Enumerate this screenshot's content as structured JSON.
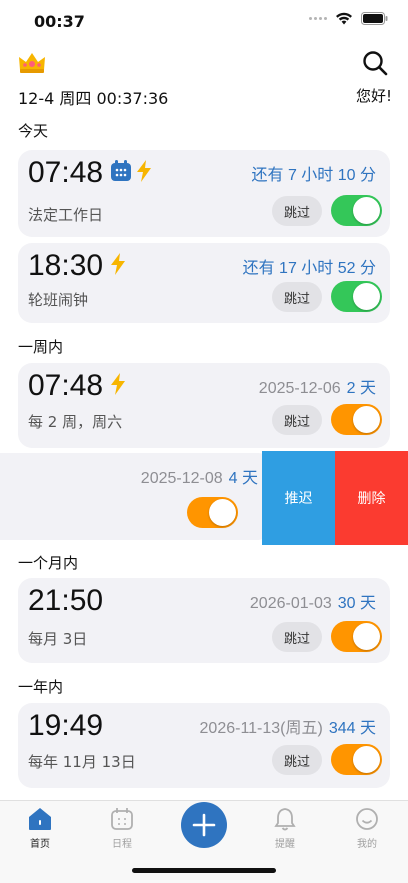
{
  "status_bar": {
    "time": "00:37"
  },
  "header": {
    "datetime": "12-4 周四 00:37:36",
    "greeting": "您好!"
  },
  "sections": {
    "today": "今天",
    "week": "一周内",
    "month": "一个月内",
    "year": "一年内"
  },
  "alarms": [
    {
      "time": "07:48",
      "remaining": "还有 7 小时 10 分",
      "subtitle": "法定工作日",
      "skip": "跳过",
      "enabled": true,
      "color": "#34c759"
    },
    {
      "time": "18:30",
      "remaining": "还有 17 小时 52 分",
      "subtitle": "轮班闹钟",
      "skip": "跳过",
      "enabled": true,
      "color": "#34c759"
    },
    {
      "time": "07:48",
      "date": "2025-12-06",
      "remaining": "2 天",
      "subtitle": "每 2 周，周六",
      "skip": "跳过",
      "enabled": true,
      "color": "#ff9500"
    },
    {
      "date": "2025-12-08",
      "remaining": "4 天",
      "enabled": true,
      "color": "#ff9500"
    },
    {
      "time": "21:50",
      "date": "2026-01-03",
      "remaining": "30 天",
      "subtitle": "每月 3日",
      "skip": "跳过",
      "enabled": true,
      "color": "#ff9500"
    },
    {
      "time": "19:49",
      "date": "2026-11-13(周五)",
      "remaining": "344 天",
      "subtitle": "每年 11月 13日",
      "skip": "跳过",
      "enabled": true,
      "color": "#ff9500"
    }
  ],
  "swipe_actions": {
    "postpone": "推迟",
    "delete": "删除"
  },
  "tabbar": {
    "home": "首页",
    "schedule": "日程",
    "reminders": "提醒",
    "mine": "我的"
  },
  "colors": {
    "accent": "#2f74c0",
    "green": "#34c759",
    "orange": "#ff9500",
    "postpone": "#2f9ee2",
    "delete": "#fb3b30",
    "lightning": "#f7b500"
  }
}
